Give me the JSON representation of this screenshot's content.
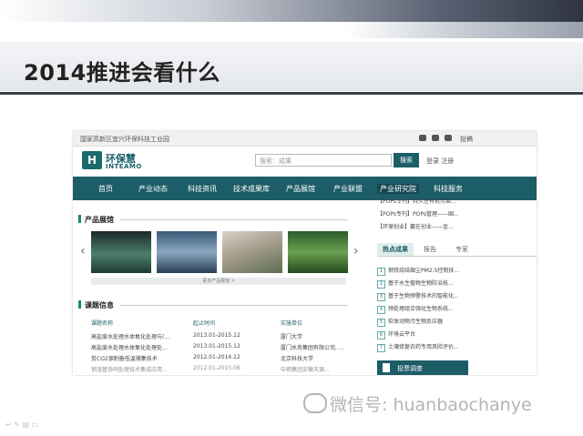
{
  "slide": {
    "title": "2014推进会看什么",
    "watermark": "微信号: huanbaochanye",
    "corner_icons": "↩ ✎ ▤ ▭"
  },
  "site": {
    "topbar_left": "国家高新区宜兴环保科技工业园",
    "topbar_right": "投稿",
    "logo_cn": "环保慧",
    "logo_en": "INTEAMO",
    "logo_mark": "H",
    "search_placeholder": "搜索：成果",
    "search_button": "搜索",
    "login": "登录 注册",
    "nav": [
      "首页",
      "产业动态",
      "科技资讯",
      "技术成果库",
      "产品展馆",
      "产业联盟",
      "产业研究院",
      "科技服务"
    ],
    "nav_active_index": 6,
    "products_heading": "产品展馆",
    "more_products": "更多产品展馆 >",
    "topics_heading": "课题信息",
    "topics_columns": [
      "课题名称",
      "起止时间",
      "实施单位"
    ],
    "topics_rows": [
      [
        "高盐废水处理水体氧化处理与(...",
        "2013.01-2015.12",
        "厦门大学"
      ],
      [
        "高盐废水处理水体氧化处理处...",
        "2013.01-2015.12",
        "厦门水务集团有限公司, ..."
      ],
      [
        "贫CO2源制备低温捕集技术",
        "2012.01-2014.12",
        "北京科技大学"
      ],
      [
        "钢渣基协同处理技术集成应用...",
        "2012.01-2015.06",
        "中钢集团安徽天源..."
      ]
    ],
    "side_top_items": [
      "【POPs专刊】持久性有机污染...",
      "【POPs专刊】POPs管理——国...",
      "【环保创业】赢在创业——金..."
    ],
    "side_tabs": [
      "热点成果",
      "报告",
      "专家"
    ],
    "side_hot_items": [
      "钢铁烧结烟尘PM2.5控制技...",
      "基于水生植物生物防治技...",
      "基于生物预警技术的智能化...",
      "预处理组合强化生物系统...",
      "软体动物污生物反应器",
      "环境云平台",
      "土壤修复农药专用风险评价..."
    ],
    "side_bottom": "投票调查"
  },
  "colors": {
    "nav_bg": "#1c5d67",
    "accent_green": "#1c8a72",
    "title_rule": "#3a3f4c"
  }
}
